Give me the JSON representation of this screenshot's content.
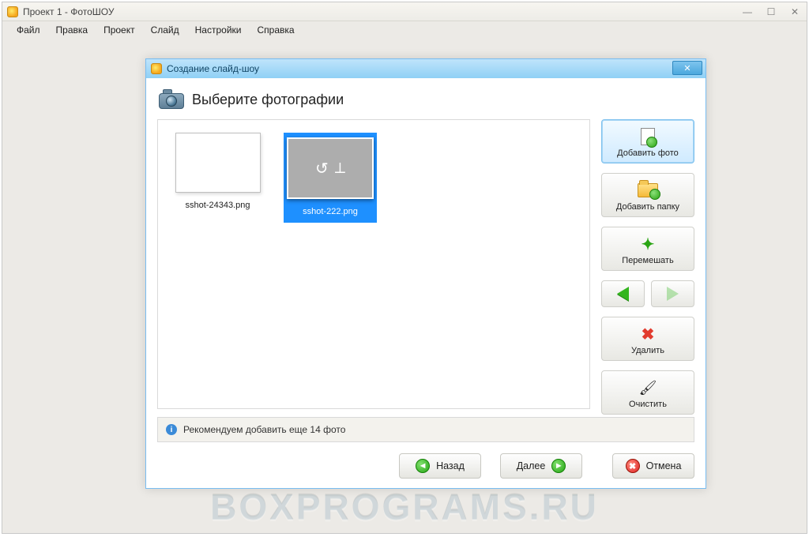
{
  "window": {
    "title": "Проект 1 - ФотоШОУ"
  },
  "menu": [
    "Файл",
    "Правка",
    "Проект",
    "Слайд",
    "Настройки",
    "Справка"
  ],
  "dialog": {
    "title": "Создание слайд-шоу",
    "heading": "Выберите фотографии",
    "thumbs": [
      {
        "caption": "sshot-24343.png",
        "selected": false
      },
      {
        "caption": "sshot-222.png",
        "selected": true
      }
    ],
    "side": {
      "add_photo": "Добавить фото",
      "add_folder": "Добавить папку",
      "shuffle": "Перемешать",
      "delete": "Удалить",
      "clear": "Очистить"
    },
    "info": "Рекомендуем добавить еще 14 фото",
    "nav": {
      "back": "Назад",
      "next": "Далее",
      "cancel": "Отмена"
    }
  },
  "watermark": "BOXPROGRAMS.RU"
}
